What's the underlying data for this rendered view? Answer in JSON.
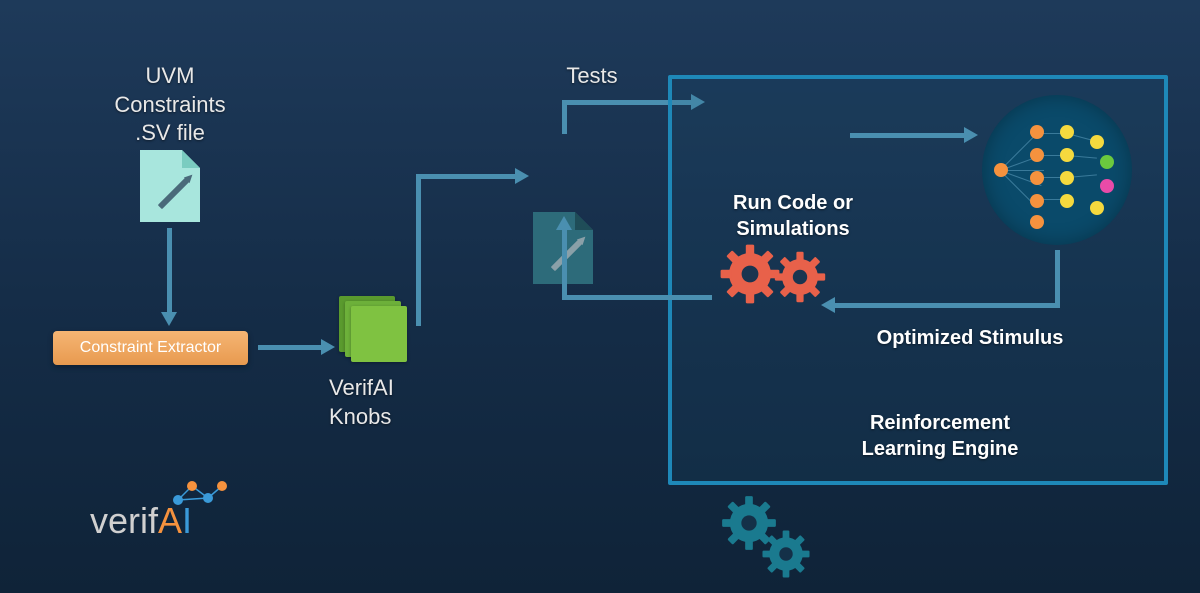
{
  "uvm": {
    "line1": "UVM",
    "line2": "Constraints",
    "line3": ".SV file"
  },
  "constraint_extractor": "Constraint Extractor",
  "knobs": {
    "line1": "VerifAI",
    "line2": "Knobs"
  },
  "tests_label": "Tests",
  "run_code": {
    "line1": "Run Code or",
    "line2": "Simulations"
  },
  "optimized_stimulus": "Optimized Stimulus",
  "rl_engine": {
    "line1": "Reinforcement",
    "line2": "Learning Engine"
  },
  "logo": {
    "prefix": "verif",
    "a": "A",
    "i": "I"
  },
  "colors": {
    "arrow": "#4a8fb0",
    "gear_red": "#e8614a",
    "gear_teal": "#1a7a8f",
    "box_border": "#1e88b8"
  }
}
